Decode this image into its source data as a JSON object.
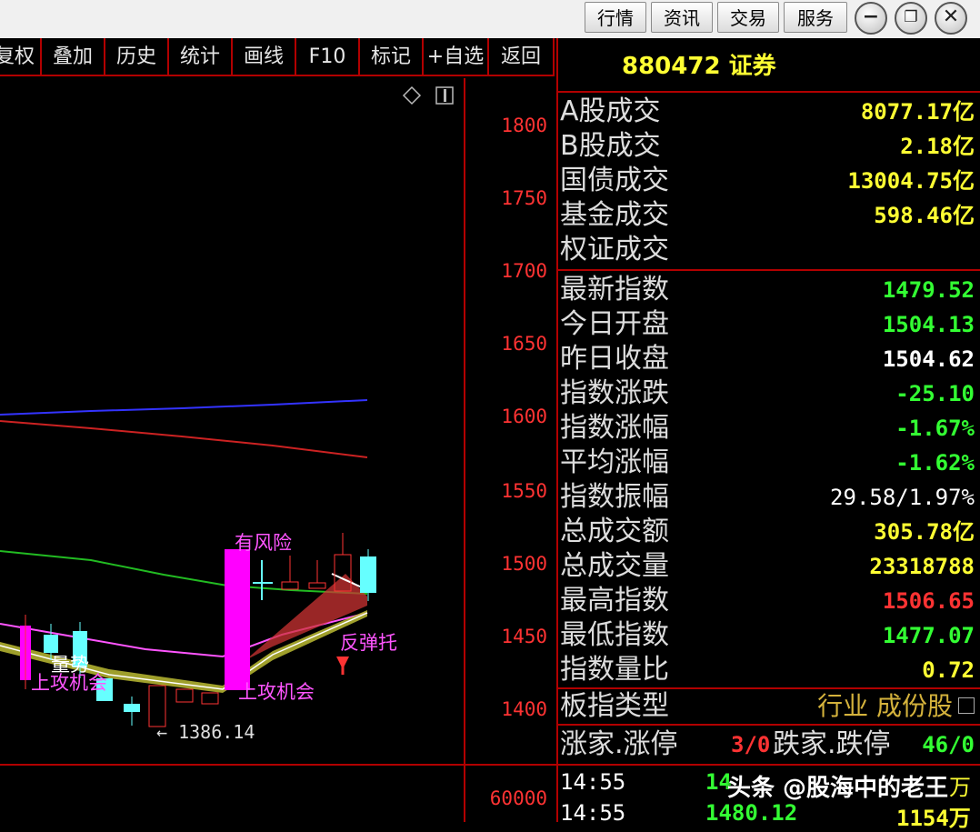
{
  "menu": {
    "items": [
      "行情",
      "资讯",
      "交易",
      "服务"
    ],
    "min_icon": "minimize-icon",
    "restore_icon": "restore-icon",
    "close_icon": "close-icon"
  },
  "toolbar": {
    "items": [
      "复权",
      "叠加",
      "历史",
      "统计",
      "画线",
      "F10",
      "标记",
      "+自选",
      "返回"
    ]
  },
  "chart": {
    "price_axis": [
      "1800",
      "1750",
      "1700",
      "1650",
      "1600",
      "1550",
      "1500",
      "1450",
      "1400"
    ],
    "volume_axis": "60000",
    "annotations": {
      "risk": "有风险",
      "attack1": "上攻机会",
      "attack2": "上攻机会",
      "rebound": "反弹托",
      "support": "量势",
      "low": "← 1386.14"
    }
  },
  "info": {
    "title": "880472 证券",
    "volume_rows": [
      {
        "label": "A股成交",
        "value": "8077.17亿",
        "color": "#ffff33"
      },
      {
        "label": "B股成交",
        "value": "2.18亿",
        "color": "#ffff33"
      },
      {
        "label": "国债成交",
        "value": "13004.75亿",
        "color": "#ffff33"
      },
      {
        "label": "基金成交",
        "value": "598.46亿",
        "color": "#ffff33"
      },
      {
        "label": "权证成交",
        "value": "",
        "color": "#ffff33"
      }
    ],
    "index_rows": [
      {
        "label": "最新指数",
        "value": "1479.52",
        "color": "#33ff33"
      },
      {
        "label": "今日开盘",
        "value": "1504.13",
        "color": "#33ff33"
      },
      {
        "label": "昨日收盘",
        "value": "1504.62",
        "color": "#ffffff"
      },
      {
        "label": "指数涨跌",
        "value": "-25.10",
        "color": "#33ff33"
      },
      {
        "label": "指数涨幅",
        "value": "-1.67%",
        "color": "#33ff33"
      },
      {
        "label": "平均涨幅",
        "value": "-1.62%",
        "color": "#33ff33"
      },
      {
        "label": "指数振幅",
        "value": "29.58/1.97%",
        "color": "#ffffff"
      },
      {
        "label": "总成交额",
        "value": "305.78亿",
        "color": "#ffff33"
      },
      {
        "label": "总成交量",
        "value": "23318788",
        "color": "#ffff33"
      },
      {
        "label": "最高指数",
        "value": "1506.65",
        "color": "#ff3333"
      },
      {
        "label": "最低指数",
        "value": "1477.07",
        "color": "#33ff33"
      },
      {
        "label": "指数量比",
        "value": "0.72",
        "color": "#ffff33"
      }
    ],
    "board_type": {
      "label": "板指类型",
      "value": "行业 成份股"
    },
    "breadth": {
      "up_label": "涨家.涨停",
      "up_value": "3/0",
      "down_label": "跌家.跌停",
      "down_value": "46/0"
    },
    "ticks": [
      {
        "time": "14:55",
        "price": "14",
        "vol": "万"
      },
      {
        "time": "14:55",
        "price": "1480.12",
        "vol": "1154万"
      }
    ]
  },
  "watermark": "头条 @股海中的老王"
}
